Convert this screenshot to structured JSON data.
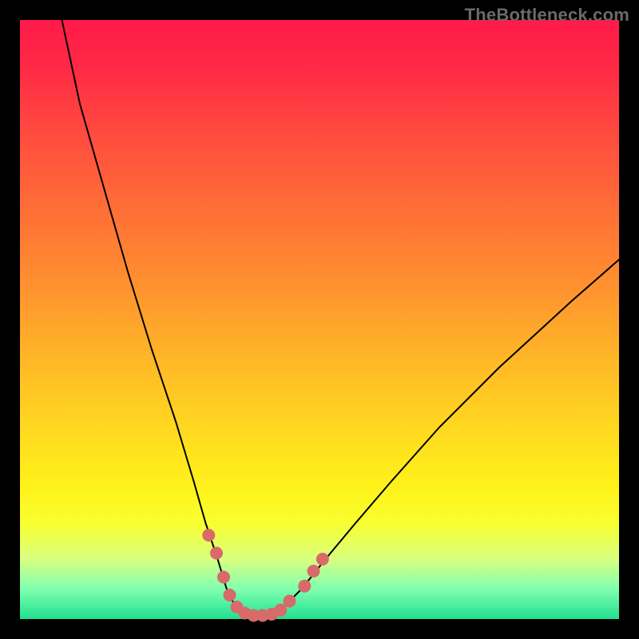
{
  "watermark": "TheBottleneck.com",
  "chart_data": {
    "type": "line",
    "title": "",
    "xlabel": "",
    "ylabel": "",
    "xlim": [
      0,
      100
    ],
    "ylim": [
      0,
      100
    ],
    "grid": false,
    "legend": false,
    "series": [
      {
        "name": "curve",
        "x": [
          7,
          10,
          14,
          18,
          22,
          26,
          29,
          31,
          33,
          34.5,
          36,
          38,
          40,
          42,
          44,
          47,
          51,
          56,
          62,
          70,
          80,
          92,
          100
        ],
        "values": [
          100,
          86,
          72,
          58,
          45,
          33,
          23,
          16,
          10,
          5,
          2,
          0.7,
          0.5,
          0.8,
          2,
          5,
          10,
          16,
          23,
          32,
          42,
          53,
          60
        ]
      }
    ],
    "markers": {
      "name": "highlight-dots",
      "color": "#d86a6a",
      "points": [
        {
          "x": 31.5,
          "y": 14
        },
        {
          "x": 32.8,
          "y": 11
        },
        {
          "x": 34.0,
          "y": 7
        },
        {
          "x": 35.0,
          "y": 4
        },
        {
          "x": 36.2,
          "y": 2
        },
        {
          "x": 37.5,
          "y": 1
        },
        {
          "x": 39.0,
          "y": 0.6
        },
        {
          "x": 40.5,
          "y": 0.6
        },
        {
          "x": 42.0,
          "y": 0.8
        },
        {
          "x": 43.5,
          "y": 1.5
        },
        {
          "x": 45.0,
          "y": 3
        },
        {
          "x": 47.5,
          "y": 5.5
        },
        {
          "x": 49.0,
          "y": 8
        },
        {
          "x": 50.5,
          "y": 10
        }
      ]
    },
    "background": {
      "type": "vertical-gradient",
      "stops": [
        {
          "pos": 0,
          "color": "#ff1a4a"
        },
        {
          "pos": 50,
          "color": "#ffb228"
        },
        {
          "pos": 80,
          "color": "#f8ff30"
        },
        {
          "pos": 100,
          "color": "#20e090"
        }
      ]
    }
  }
}
